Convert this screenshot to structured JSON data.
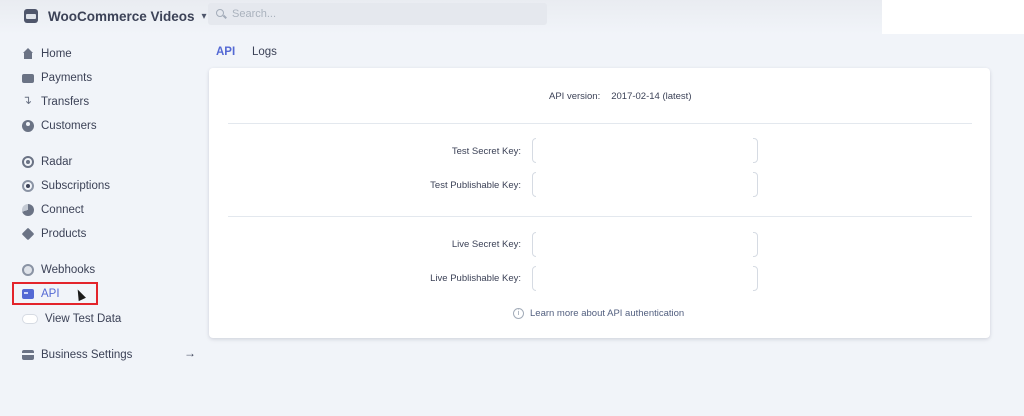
{
  "account": {
    "name": "WooCommerce Videos",
    "icon": "store-icon"
  },
  "search": {
    "placeholder": "Search..."
  },
  "sidebar": {
    "items": [
      {
        "label": "Home",
        "icon": "home-icon"
      },
      {
        "label": "Payments",
        "icon": "payments-icon"
      },
      {
        "label": "Transfers",
        "icon": "transfers-icon"
      },
      {
        "label": "Customers",
        "icon": "customers-icon"
      },
      {
        "label": "Radar",
        "icon": "radar-icon"
      },
      {
        "label": "Subscriptions",
        "icon": "subscriptions-icon"
      },
      {
        "label": "Connect",
        "icon": "connect-icon"
      },
      {
        "label": "Products",
        "icon": "products-icon"
      },
      {
        "label": "Webhooks",
        "icon": "webhooks-icon"
      },
      {
        "label": "API",
        "icon": "api-icon",
        "active": true
      },
      {
        "label": "View Test Data",
        "icon": "toggle-icon"
      },
      {
        "label": "Business Settings",
        "icon": "settings-icon"
      }
    ]
  },
  "tabs": [
    {
      "label": "API",
      "active": true
    },
    {
      "label": "Logs",
      "active": false
    }
  ],
  "card": {
    "api_version_label": "API version:",
    "api_version_value": "2017-02-14 (latest)",
    "keys": [
      {
        "label": "Test Secret Key:",
        "value": ""
      },
      {
        "label": "Test Publishable Key:",
        "value": ""
      },
      {
        "label": "Live Secret Key:",
        "value": ""
      },
      {
        "label": "Live Publishable Key:",
        "value": ""
      }
    ],
    "learn_more": "Learn more about API authentication"
  },
  "colors": {
    "accent": "#5469d4",
    "highlight": "#e3242b",
    "background": "#f1f4f9"
  }
}
